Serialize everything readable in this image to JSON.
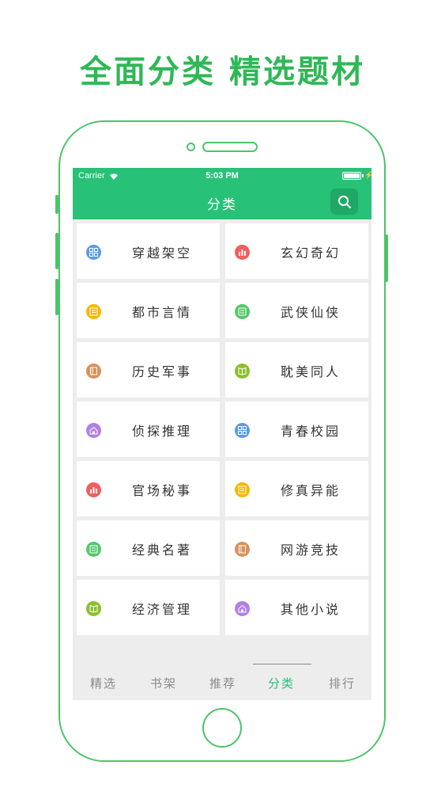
{
  "promo": {
    "headline": "全面分类 精选题材"
  },
  "status_bar": {
    "carrier": "Carrier",
    "time": "5:03 PM"
  },
  "nav": {
    "title": "分类",
    "search_icon": "search-icon"
  },
  "categories": [
    {
      "label": "穿越架空",
      "icon": "grid-icon",
      "color": "#5b9be6"
    },
    {
      "label": "玄幻奇幻",
      "icon": "chart-icon",
      "color": "#ef5f5f"
    },
    {
      "label": "都市言情",
      "icon": "document-icon",
      "color": "#f5b800"
    },
    {
      "label": "武侠仙侠",
      "icon": "list-icon",
      "color": "#54c96b"
    },
    {
      "label": "历史军事",
      "icon": "book-icon",
      "color": "#d9925a"
    },
    {
      "label": "耽美同人",
      "icon": "open-book-icon",
      "color": "#8dbf2e"
    },
    {
      "label": "侦探推理",
      "icon": "home-icon",
      "color": "#b27fe6"
    },
    {
      "label": "青春校园",
      "icon": "grid-icon",
      "color": "#5b9be6"
    },
    {
      "label": "官场秘事",
      "icon": "chart-icon",
      "color": "#ef5f5f"
    },
    {
      "label": "修真异能",
      "icon": "document-icon",
      "color": "#f5b800"
    },
    {
      "label": "经典名著",
      "icon": "list-icon",
      "color": "#54c96b"
    },
    {
      "label": "网游竞技",
      "icon": "book-icon",
      "color": "#d9925a"
    },
    {
      "label": "经济管理",
      "icon": "open-book-icon",
      "color": "#8dbf2e"
    },
    {
      "label": "其他小说",
      "icon": "home-icon",
      "color": "#b27fe6"
    }
  ],
  "tabs": [
    {
      "label": "精选",
      "active": false
    },
    {
      "label": "书架",
      "active": false
    },
    {
      "label": "推荐",
      "active": false
    },
    {
      "label": "分类",
      "active": true
    },
    {
      "label": "排行",
      "active": false
    }
  ],
  "colors": {
    "brand_green": "#27c177",
    "frame_green": "#4cc46a",
    "headline_green": "#2eb856"
  }
}
